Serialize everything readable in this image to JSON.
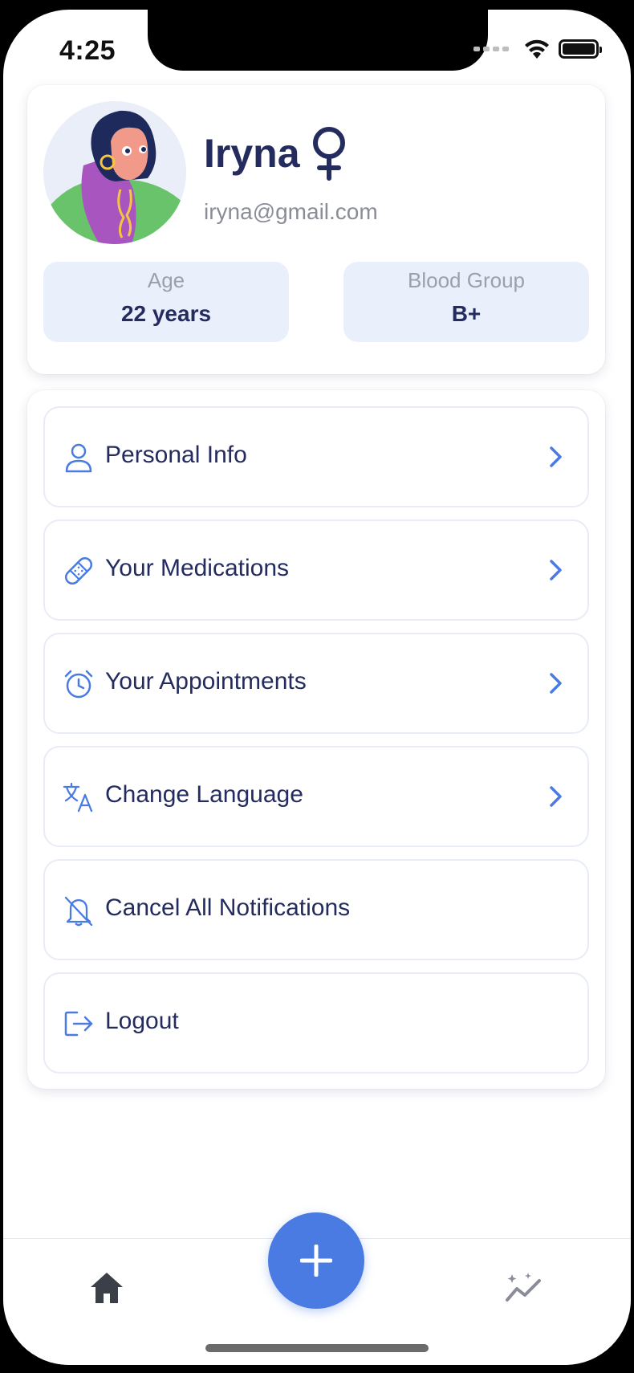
{
  "status_bar": {
    "time": "4:25"
  },
  "profile": {
    "name": "Iryna",
    "email": "iryna@gmail.com",
    "gender_icon": "female-symbol-icon",
    "stats": [
      {
        "label": "Age",
        "value": "22 years"
      },
      {
        "label": "Blood Group",
        "value": "B+"
      }
    ]
  },
  "menu": {
    "items": [
      {
        "label": "Personal Info",
        "icon": "user-icon",
        "chevron": true
      },
      {
        "label": "Your Medications",
        "icon": "bandage-icon",
        "chevron": true
      },
      {
        "label": "Your Appointments",
        "icon": "alarm-clock-icon",
        "chevron": true
      },
      {
        "label": "Change Language",
        "icon": "translate-icon",
        "chevron": true
      },
      {
        "label": "Cancel All Notifications",
        "icon": "bell-off-icon",
        "chevron": false
      },
      {
        "label": "Logout",
        "icon": "logout-icon",
        "chevron": false
      }
    ]
  },
  "tabbar": {
    "left": "home-icon",
    "center": "plus-icon",
    "right": "stats-sparkle-icon"
  },
  "colors": {
    "accent": "#4a7be3",
    "text_primary": "#242b5e",
    "text_secondary": "#8a8d97",
    "stat_bg": "#e9effb"
  }
}
